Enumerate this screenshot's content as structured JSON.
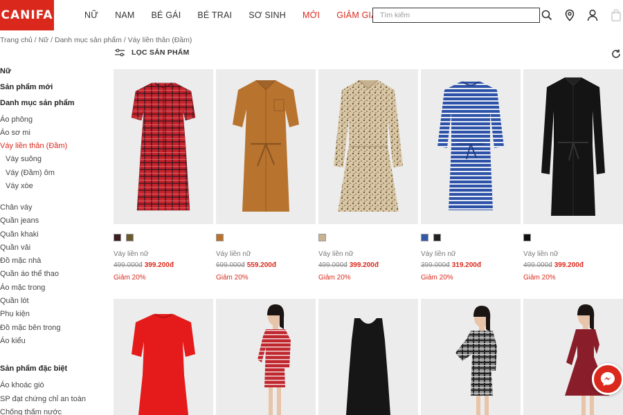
{
  "header": {
    "logo": "CANIFA",
    "nav": [
      {
        "label": "NỮ",
        "highlight": false
      },
      {
        "label": "NAM",
        "highlight": false
      },
      {
        "label": "BÉ GÁI",
        "highlight": false
      },
      {
        "label": "BÉ TRAI",
        "highlight": false
      },
      {
        "label": "SƠ SINH",
        "highlight": false
      },
      {
        "label": "MỚI",
        "highlight": true
      },
      {
        "label": "GIẢM GIÁ",
        "highlight": true
      }
    ],
    "search_placeholder": "Tìm kiếm",
    "icons": [
      "search-icon",
      "location-icon",
      "user-icon",
      "cart-icon"
    ]
  },
  "breadcrumb": "Trang chủ / Nữ / Danh mục sản phẩm / Váy liền thân (Đầm)",
  "filter": {
    "label": "LỌC SẢN PHẨM"
  },
  "sidebar": {
    "items": [
      {
        "label": "Nữ",
        "style": "bold"
      },
      {
        "label": "Sản phẩm mới",
        "style": "bold"
      },
      {
        "label": "Danh mục sản phẩm",
        "style": "bold"
      },
      {
        "label": "Áo phông",
        "style": "normal"
      },
      {
        "label": "Áo sơ mi",
        "style": "normal"
      },
      {
        "label": "Váy liền thân (Đầm)",
        "style": "active"
      },
      {
        "label": "Váy suông",
        "style": "sub"
      },
      {
        "label": "Váy (Đầm) ôm",
        "style": "sub"
      },
      {
        "label": "Váy xòe",
        "style": "sub"
      },
      {
        "label": "Chân váy",
        "style": "normal"
      },
      {
        "label": "Quần jeans",
        "style": "normal"
      },
      {
        "label": "Quần khaki",
        "style": "normal"
      },
      {
        "label": "Quần vải",
        "style": "normal"
      },
      {
        "label": "Đồ mặc nhà",
        "style": "normal"
      },
      {
        "label": "Quần áo thể thao",
        "style": "normal"
      },
      {
        "label": "Áo mặc trong",
        "style": "normal"
      },
      {
        "label": "Quần lót",
        "style": "normal"
      },
      {
        "label": "Phụ kiện",
        "style": "normal"
      },
      {
        "label": "Đồ mặc bên trong",
        "style": "normal"
      },
      {
        "label": "Áo kiểu",
        "style": "normal"
      },
      {
        "label": "Sản phẩm đặc biệt",
        "style": "bold"
      },
      {
        "label": "Áo khoác gió",
        "style": "normal"
      },
      {
        "label": "SP đạt chứng chỉ an toàn",
        "style": "normal"
      },
      {
        "label": "Chống thấm nước",
        "style": "normal"
      }
    ]
  },
  "products": [
    {
      "name": "Váy liền nữ",
      "old_price": "499.000đ",
      "new_price": "399.200đ",
      "discount": "Giảm 20%",
      "swatches": [
        "#3a1e22",
        "#6b5a2e"
      ],
      "dress": "plaid-red"
    },
    {
      "name": "Váy liền nữ",
      "old_price": "699.000đ",
      "new_price": "559.200đ",
      "discount": "Giảm 20%",
      "swatches": [
        "#b8742f"
      ],
      "dress": "shirt-orange"
    },
    {
      "name": "Váy liền nữ",
      "old_price": "499.000đ",
      "new_price": "399.200đ",
      "discount": "Giảm 20%",
      "swatches": [
        "#c8b290"
      ],
      "dress": "floral"
    },
    {
      "name": "Váy liền nữ",
      "old_price": "399.000đ",
      "new_price": "319.200đ",
      "discount": "Giảm 20%",
      "swatches": [
        "#3458a8",
        "#222"
      ],
      "dress": "stripe-blue"
    },
    {
      "name": "Váy liền nữ",
      "old_price": "499.000đ",
      "new_price": "399.200đ",
      "discount": "Giảm 20%",
      "swatches": [
        "#111"
      ],
      "dress": "black-shirt"
    },
    {
      "dress": "red-tee"
    },
    {
      "dress": "model-stripe-red"
    },
    {
      "dress": "black-tank"
    },
    {
      "dress": "model-plaid"
    },
    {
      "dress": "model-burgundy"
    }
  ],
  "colors": {
    "brand": "#da291c",
    "image_bg": "#ececec"
  }
}
